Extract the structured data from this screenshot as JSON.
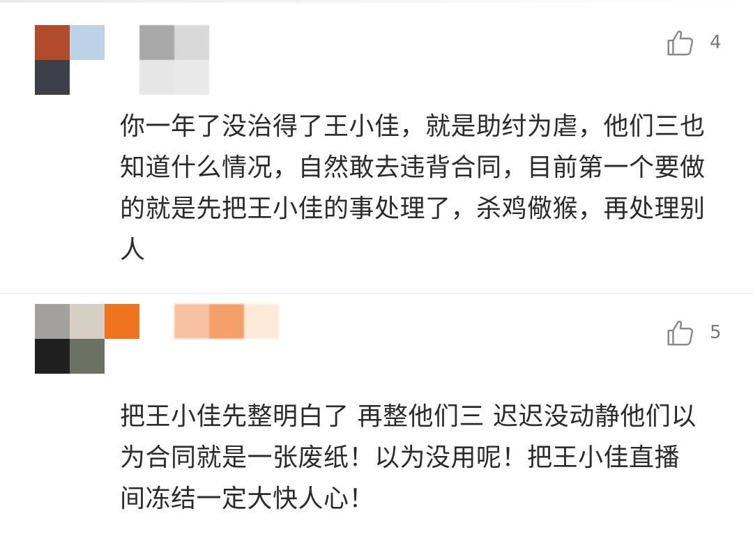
{
  "colors": {
    "text": "#2b2b2b",
    "like_count": "#777777",
    "divider": "#efefef"
  },
  "comments": [
    {
      "avatar_tiles": [
        "#b24a2c",
        "#bcd2e6",
        "#3d4048",
        "#ffffff"
      ],
      "name_tiles": [
        "#a9a9a9",
        "#d8d8d8",
        "#e6e6e6",
        "#e9e9e9"
      ],
      "likes": "4",
      "like_icon": "thumbs-up-icon",
      "lines": [
        "你一年了没治得了王小佳，就是助纣为虐，他们三也",
        "知道什么情况，自然敢去违背合同，目前第一个要做",
        "的就是先把王小佳的事处理了，杀鸡儆猴，再处理别",
        "人"
      ]
    },
    {
      "avatar_tiles": [
        "#a3a1a0",
        "#d6d0c4",
        "#f0731e",
        "#1f1f1f",
        "#6c7263",
        "#ffffff"
      ],
      "name_tiles": [
        "#f8c2a2",
        "#f3a06a",
        "#fdebd9"
      ],
      "likes": "5",
      "like_icon": "thumbs-up-icon",
      "lines": [
        "把王小佳先整明白了 再整他们三 迟迟没动静他们以",
        "为合同就是一张废纸！以为没用呢！把王小佳直播",
        "间冻结一定大快人心！"
      ]
    }
  ]
}
